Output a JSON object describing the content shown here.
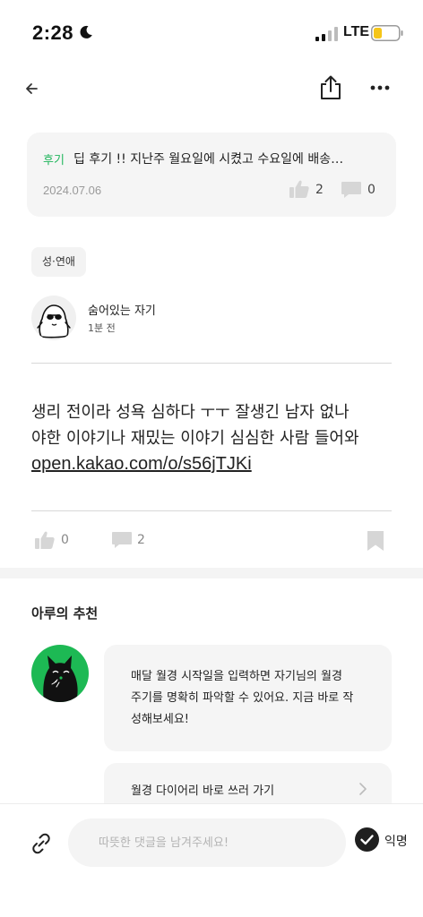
{
  "status_bar": {
    "time": "2:28",
    "network": "LTE"
  },
  "nav": {
    "icons": [
      "back-arrow-icon",
      "share-icon",
      "more-icon"
    ]
  },
  "parent_post": {
    "tag": "후기",
    "title": "딥 후기 !!  지난주 월요일에 시켰고 수요일에 배송…",
    "date": "2024.07.06",
    "likes": "2",
    "comments": "0"
  },
  "post": {
    "category": "성·연애",
    "author": "숨어있는 자기",
    "time_ago": "1분 전",
    "body_lines": [
      "생리 전이라 성욕 심하다 ㅜㅜ 잘생긴 남자 없나",
      "야한 이야기나 재밌는 이야기 심심한 사람 들어와"
    ],
    "link": "open.kakao.com/o/s56jTJKi",
    "likes": "0",
    "comments": "2"
  },
  "recommendation": {
    "title": "아루의 추천",
    "message_lines": [
      "매달 월경 시작일을 입력하면 자기님의 월경",
      "주기를 명확히 파악할 수 있어요. 지금 바로 작",
      "성해보세요!"
    ],
    "link_label": "월경 다이어리 바로 쓰러 가기"
  },
  "comment_bar": {
    "placeholder": "따뜻한 댓글을 남겨주세요!",
    "anonymous_label": "익명"
  },
  "colors": {
    "accent_green": "#1fb55b",
    "card_bg": "#f5f5f5",
    "divider": "#d8d8d8"
  }
}
